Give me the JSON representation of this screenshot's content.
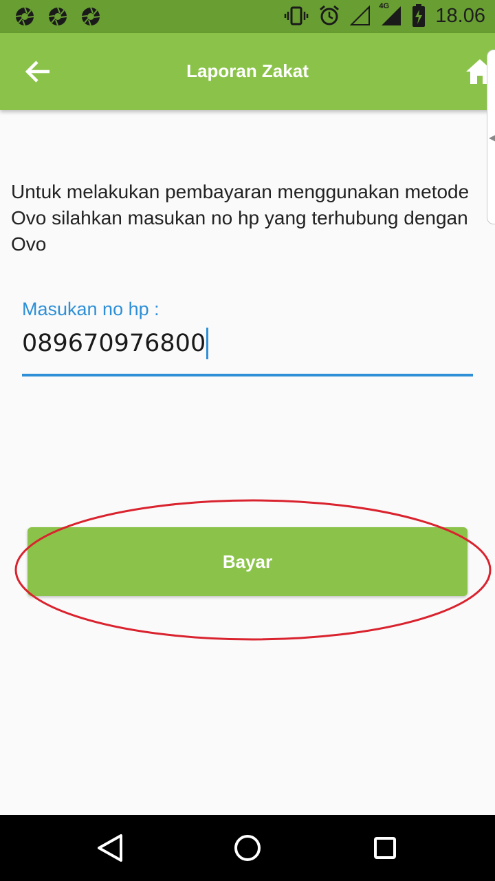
{
  "status_bar": {
    "time": "18.06",
    "network_label": "4G",
    "left_icons": [
      "aperture-icon",
      "aperture-icon",
      "aperture-icon"
    ],
    "right_icons": [
      "vibrate-icon",
      "alarm-icon",
      "signal-empty-icon",
      "signal-4g-icon",
      "battery-charging-icon"
    ]
  },
  "app_bar": {
    "title": "Laporan Zakat",
    "back_icon": "arrow-left-icon",
    "home_icon": "home-icon",
    "color": "#8bc34a"
  },
  "main": {
    "instruction": "Untuk melakukan pembayaran menggunakan metode Ovo silahkan masukan no hp yang terhubung dengan Ovo",
    "phone_field": {
      "label": "Masukan no hp :",
      "value": "089670976800",
      "accent_color": "#2e8fd6"
    },
    "pay_button": {
      "label": "Bayar"
    },
    "annotation_color": "#d9232e"
  },
  "nav_bar": {
    "icons": [
      "back-triangle-icon",
      "home-circle-icon",
      "recents-square-icon"
    ]
  }
}
